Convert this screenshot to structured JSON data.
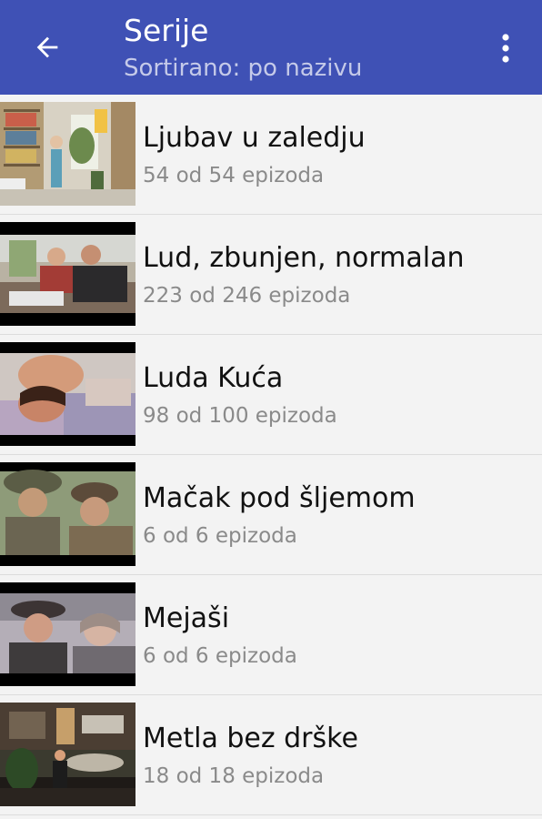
{
  "header": {
    "title": "Serije",
    "subtitle": "Sortirano: po nazivu",
    "back_icon": "arrow-left-icon",
    "menu_icon": "more-vert-icon",
    "color": "#3f51b5"
  },
  "series": [
    {
      "title": "Ljubav u zaledju",
      "episodes": "54 od 54 epizoda"
    },
    {
      "title": "Lud, zbunjen, normalan",
      "episodes": "223 od 246 epizoda"
    },
    {
      "title": "Luda Kuća",
      "episodes": "98 od 100 epizoda"
    },
    {
      "title": "Mačak pod šljemom",
      "episodes": "6 od 6 epizoda"
    },
    {
      "title": "Mejaši",
      "episodes": "6 od 6 epizoda"
    },
    {
      "title": "Metla bez drške",
      "episodes": "18 od 18 epizoda"
    }
  ]
}
